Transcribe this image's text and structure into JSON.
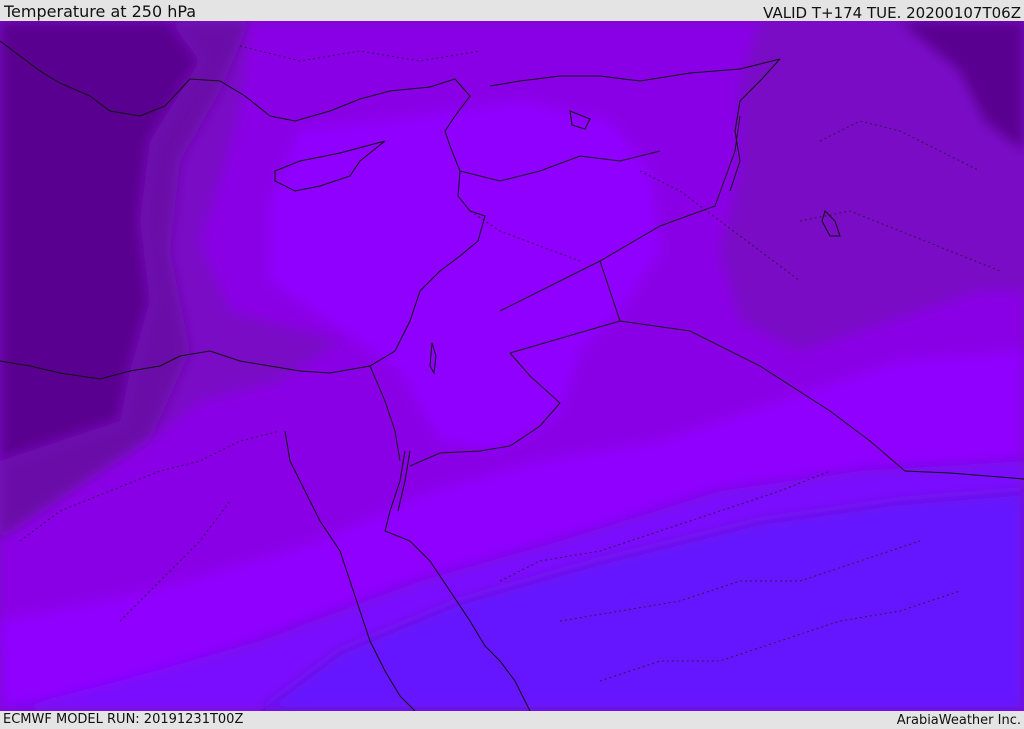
{
  "header": {
    "title": "Temperature at 250 hPa",
    "valid_time": "VALID T+174 TUE. 20200107T06Z"
  },
  "footer": {
    "model_run": "ECMWF MODEL RUN: 20191231T00Z",
    "credit": "ArabiaWeather Inc."
  },
  "map": {
    "variable": "temperature",
    "pressure_level_hPa": 250,
    "palette": {
      "coldest": "#5a0090",
      "colder": "#6a0aa8",
      "cold": "#7a0cc6",
      "mid": "#8a00e6",
      "mild": "#8f00ff",
      "warm": "#7a0aff",
      "warmest": "#6614ff"
    },
    "line_colors": {
      "coastline": "#111111",
      "border": "#1a1a1a"
    }
  }
}
